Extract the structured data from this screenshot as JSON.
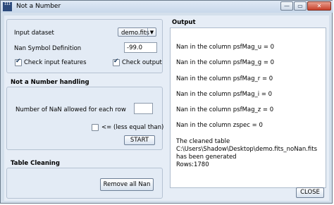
{
  "window": {
    "title": "Not a Number",
    "icon_text": "III",
    "min_glyph": "—",
    "max_glyph": "▭",
    "close_glyph": "✕"
  },
  "input_panel": {
    "dataset_label": "Input dataset",
    "dataset_value": "demo.fits",
    "nan_label": "Nan Symbol Definition",
    "nan_value": "-99.0",
    "check_input_label": "Check input features",
    "check_input_checked": true,
    "check_output_label": "Check output",
    "check_output_checked": true
  },
  "nan_handling": {
    "title": "Not a Number handling",
    "allowed_label": "Number of NaN allowed for each row",
    "allowed_value": "",
    "less_equal_label": "<= (less equal than)",
    "less_equal_checked": false,
    "start_label": "START"
  },
  "table_cleaning": {
    "title": "Table Cleaning",
    "remove_label": "Remove all Nan"
  },
  "output": {
    "title": "Output",
    "lines": [
      "Nan in the column psfMag_u = 0",
      "Nan in the column psfMag_g = 0",
      "Nan in the column psfMag_r = 0",
      "Nan in the column psfMag_i = 0",
      "Nan in the column psfMag_z = 0",
      "Nan in the column zspec = 0",
      "The cleaned table",
      "C:\\Users\\Shadow\\Desktop\\demo.fits_noNan.fits",
      "has been generated",
      "Rows:1780"
    ]
  },
  "close_label": "CLOSE"
}
